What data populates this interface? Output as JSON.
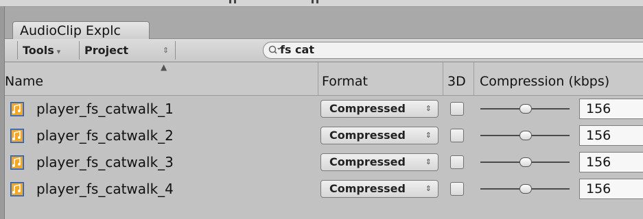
{
  "window": {
    "tab_label": "AudioClip Explc"
  },
  "toolbar": {
    "tools_label": "Tools",
    "tools_arrow": "▾",
    "project_label": "Project",
    "project_arrow": "⇕"
  },
  "search": {
    "value": "fs cat",
    "icon": "magnifier-icon"
  },
  "columns": {
    "name": "Name",
    "format": "Format",
    "three_d": "3D",
    "compression": "Compression (kbps)",
    "sort_indicator": "▲"
  },
  "rows": [
    {
      "name": "player_fs_catwalk_1",
      "format": "Compressed",
      "three_d": false,
      "compression_kbps": "156"
    },
    {
      "name": "player_fs_catwalk_2",
      "format": "Compressed",
      "three_d": false,
      "compression_kbps": "156"
    },
    {
      "name": "player_fs_catwalk_3",
      "format": "Compressed",
      "three_d": false,
      "compression_kbps": "156"
    },
    {
      "name": "player_fs_catwalk_4",
      "format": "Compressed",
      "three_d": false,
      "compression_kbps": "156"
    }
  ],
  "colors": {
    "panel_bg": "#c2c2c2",
    "audio_icon_orange": "#f5a623",
    "audio_icon_blue": "#4a7fd0"
  }
}
